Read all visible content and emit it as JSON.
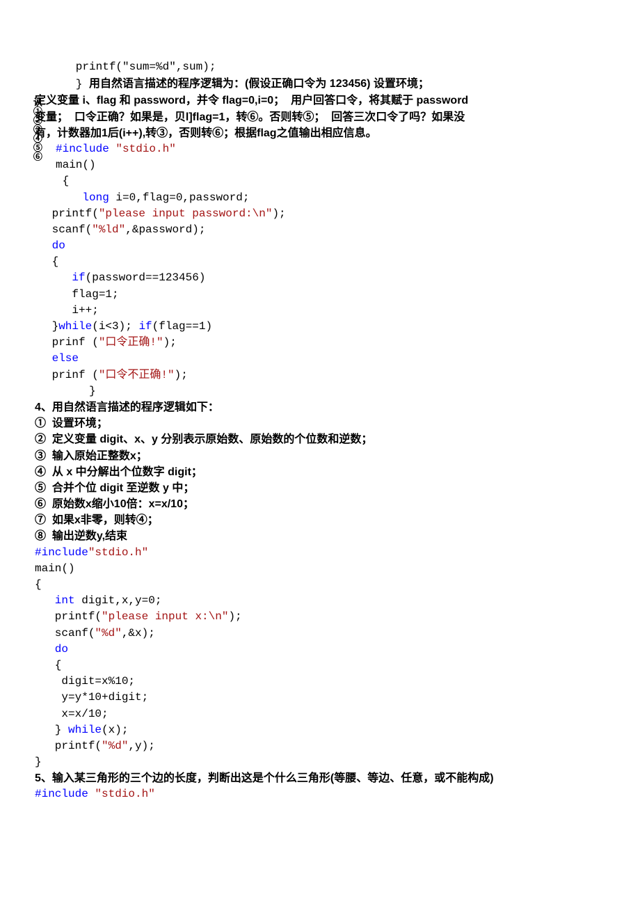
{
  "marker_vertical": "认①②③④⑤⑥",
  "l1": "   printf(\"sum=%d\",sum);",
  "l2_a": "   } ",
  "l2_b": "用自然语言描述的程序逻辑为：(假设正确口令为 123456) 设置环境；",
  "l3": "定义变量 i、flag 和 password，并令 flag=0,i=0；  用户回答口令，将其赋于 password",
  "l4": "变量；  口令正确？如果是，贝l]flag=1，转⑥。否则转⑤；  回答三次口令了吗？如果没",
  "l5": "有，计数器加1后(i++),转③，否则转⑥；根据flag之值输出相应信息。",
  "l6_a": "#include ",
  "l6_b": "\"stdio.h\"",
  "l7": "main()",
  "l8": " {",
  "l9_a": "    long",
  "l9_b": " i=0,flag=0,password;",
  "l10": " printf(",
  "l10_b": "\"please input password:\\n\"",
  "l10_c": ");",
  "l11": " scanf(",
  "l11_b": "\"%ld\"",
  "l11_c": ",&password);",
  "l12": " do",
  "l13": " {",
  "l14_a": "    if",
  "l14_b": "(password==123456)",
  "l15": "    flag=1;",
  "l16": "    i++;",
  "l17_a": " }",
  "l17_b": "while",
  "l17_c": "(i<3); ",
  "l17_d": "if",
  "l17_e": "(flag==1)",
  "l18": " prinf (",
  "l18_b": "\"口令正确!\"",
  "l18_c": ");",
  "l19": " else",
  "l20": " prinf (",
  "l20_b": "\"口令不正确!\"",
  "l20_c": ");",
  "l21": "     }",
  "q4_h": "4、用自然语言描述的程序逻辑如下：",
  "q4_1": "①  设置环境；",
  "q4_2": "②  定义变量 digit、x、y 分别表示原始数、原始数的个位数和逆数；",
  "q4_3": "③  输入原始正整数x；",
  "q4_4": "④  从 x 中分解出个位数字 digit；",
  "q4_5": "⑤  合并个位 digit 至逆数 y 中；",
  "q4_6": "⑥  原始数x缩小10倍：x=x/10；",
  "q4_7": "⑦  如果x非零，则转④；",
  "q4_8": "⑧  输出逆数y,结束",
  "p4_1a": "#include",
  "p4_1b": "\"stdio.h\"",
  "p4_2": "main()",
  "p4_3": "{",
  "p4_4a": "   int",
  "p4_4b": " digit,x,y=0;",
  "p4_5a": "   printf(",
  "p4_5b": "\"please input x:\\n\"",
  "p4_5c": ");",
  "p4_6a": "   scanf(",
  "p4_6b": "\"%d\"",
  "p4_6c": ",&x);",
  "p4_7": "   do",
  "p4_8": "   {",
  "p4_9": "    digit=x%10;",
  "p4_10": "    y=y*10+digit;",
  "p4_11": "    x=x/10;",
  "p4_12a": "   } ",
  "p4_12b": "while",
  "p4_12c": "(x);",
  "p4_13a": "   printf(",
  "p4_13b": "\"%d\"",
  "p4_13c": ",y);",
  "p4_14": "}",
  "q5": "5、输入某三角形的三个边的长度，判断出这是个什么三角形(等腰、等边、任意，或不能构成)",
  "p5_1a": "#include ",
  "p5_1b": "\"stdio.h\""
}
